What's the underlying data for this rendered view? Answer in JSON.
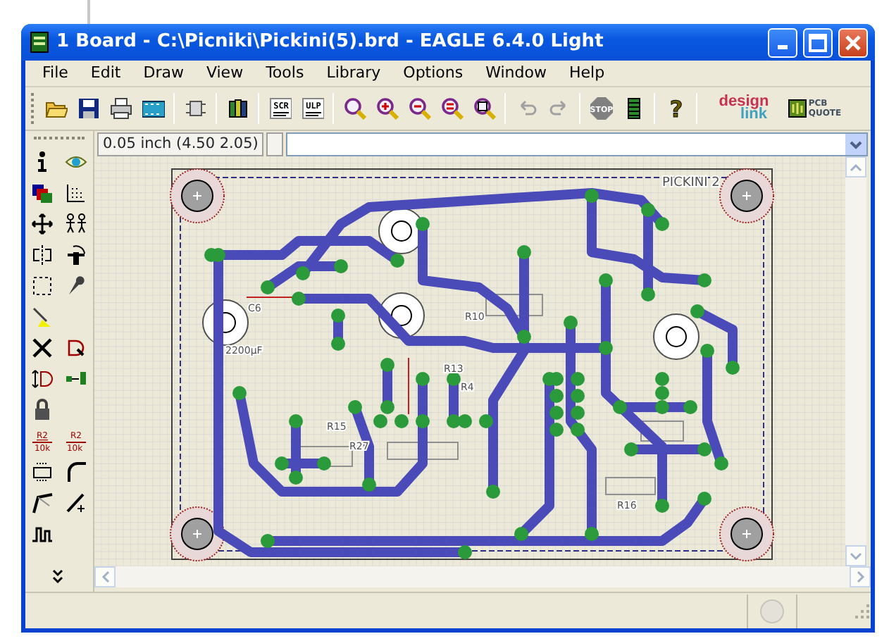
{
  "window": {
    "title": "1 Board - C:\\Picniki\\Pickini(5).brd - EAGLE 6.4.0 Light"
  },
  "menu": [
    "File",
    "Edit",
    "Draw",
    "View",
    "Tools",
    "Library",
    "Options",
    "Window",
    "Help"
  ],
  "toolbar": [
    {
      "kind": "open"
    },
    {
      "kind": "save"
    },
    {
      "kind": "print"
    },
    {
      "kind": "cam"
    },
    {
      "kind": "sep"
    },
    {
      "kind": "switch"
    },
    {
      "kind": "sep"
    },
    {
      "kind": "library"
    },
    {
      "kind": "sep"
    },
    {
      "kind": "script",
      "text": "SCR"
    },
    {
      "kind": "script",
      "text": "ULP"
    },
    {
      "kind": "sep"
    },
    {
      "kind": "zoomfit"
    },
    {
      "kind": "zoomin"
    },
    {
      "kind": "zoomout"
    },
    {
      "kind": "zoomsel"
    },
    {
      "kind": "redraw"
    },
    {
      "kind": "sep"
    },
    {
      "kind": "undo"
    },
    {
      "kind": "redo"
    },
    {
      "kind": "sep"
    },
    {
      "kind": "stop",
      "text": "STOP"
    },
    {
      "kind": "drc"
    },
    {
      "kind": "sep"
    },
    {
      "kind": "help",
      "text": "?"
    },
    {
      "kind": "sep"
    },
    {
      "kind": "designlink",
      "text": "design",
      "text2": "link"
    },
    {
      "kind": "pcbquote",
      "text": "PCB",
      "text2": "QUOTE"
    }
  ],
  "command_bar": {
    "coordinates": "0.05 inch (4.50 2.05)"
  },
  "tools": [
    {
      "kind": "info"
    },
    {
      "kind": "eye"
    },
    {
      "kind": "layers"
    },
    {
      "kind": "grid"
    },
    {
      "kind": "move"
    },
    {
      "kind": "copy"
    },
    {
      "kind": "mirror"
    },
    {
      "kind": "rotate"
    },
    {
      "kind": "group"
    },
    {
      "kind": "wrench"
    },
    {
      "kind": "route"
    },
    {
      "kind": "blank"
    },
    {
      "kind": "delete"
    },
    {
      "kind": "add"
    },
    {
      "kind": "replace"
    },
    {
      "kind": "pinswap"
    },
    {
      "kind": "lock"
    },
    {
      "kind": "blank"
    },
    {
      "kind": "name",
      "text": "R2",
      "text2": "10k"
    },
    {
      "kind": "value",
      "text": "R2",
      "text2": "10k"
    },
    {
      "kind": "smash"
    },
    {
      "kind": "miter"
    },
    {
      "kind": "split"
    },
    {
      "kind": "wire"
    },
    {
      "kind": "wave"
    },
    {
      "kind": "blank"
    },
    {
      "kind": "more"
    }
  ],
  "board": {
    "labels": [
      {
        "text": "PICKINI 2"
      },
      {
        "text": "2200µF"
      },
      {
        "text": "C6"
      },
      {
        "text": "R4"
      },
      {
        "text": "R13"
      },
      {
        "text": "R15"
      },
      {
        "text": "R27"
      },
      {
        "text": "R10"
      },
      {
        "text": "R16"
      }
    ]
  }
}
